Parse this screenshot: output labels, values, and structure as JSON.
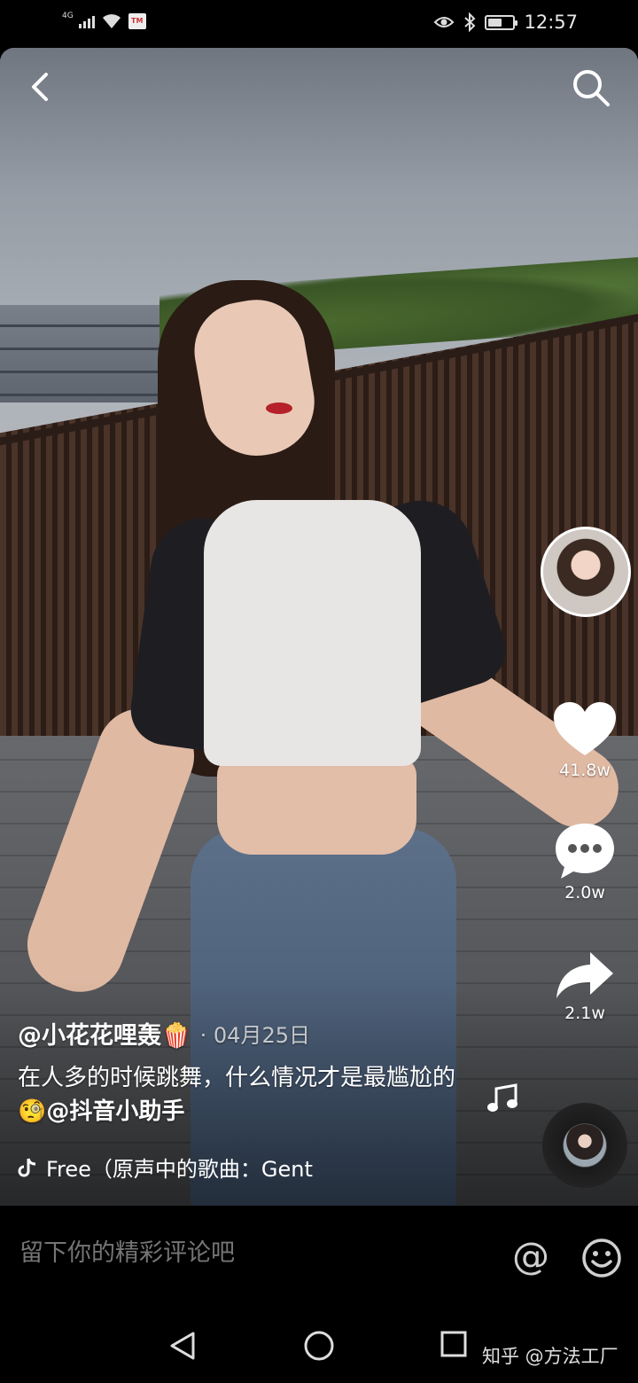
{
  "status_bar": {
    "network": "4G",
    "time": "12:57",
    "battery_level": 0.55,
    "icons": [
      "signal-icon",
      "wifi-icon",
      "app-notification-icon",
      "eye-comfort-icon",
      "bluetooth-icon",
      "battery-icon"
    ]
  },
  "video": {
    "author": "@小花花哩轰",
    "author_emoji": "🍿",
    "date_sep": "·",
    "date": "04月25日",
    "desc_text": "在人多的时候跳舞，什么情况才是最尴尬的",
    "desc_emoji": "🧐",
    "mention": "@抖音小助手",
    "music": "Free（原声中的歌曲：Gent"
  },
  "actions": {
    "likes": "41.8w",
    "comments": "2.0w",
    "shares": "2.1w"
  },
  "comment_bar": {
    "placeholder": "留下你的精彩评论吧",
    "at_symbol": "@"
  },
  "watermark": "知乎 @方法工厂",
  "colors": {
    "background": "#000000",
    "text_primary": "#ffffff",
    "placeholder": "#8a8a8a"
  }
}
